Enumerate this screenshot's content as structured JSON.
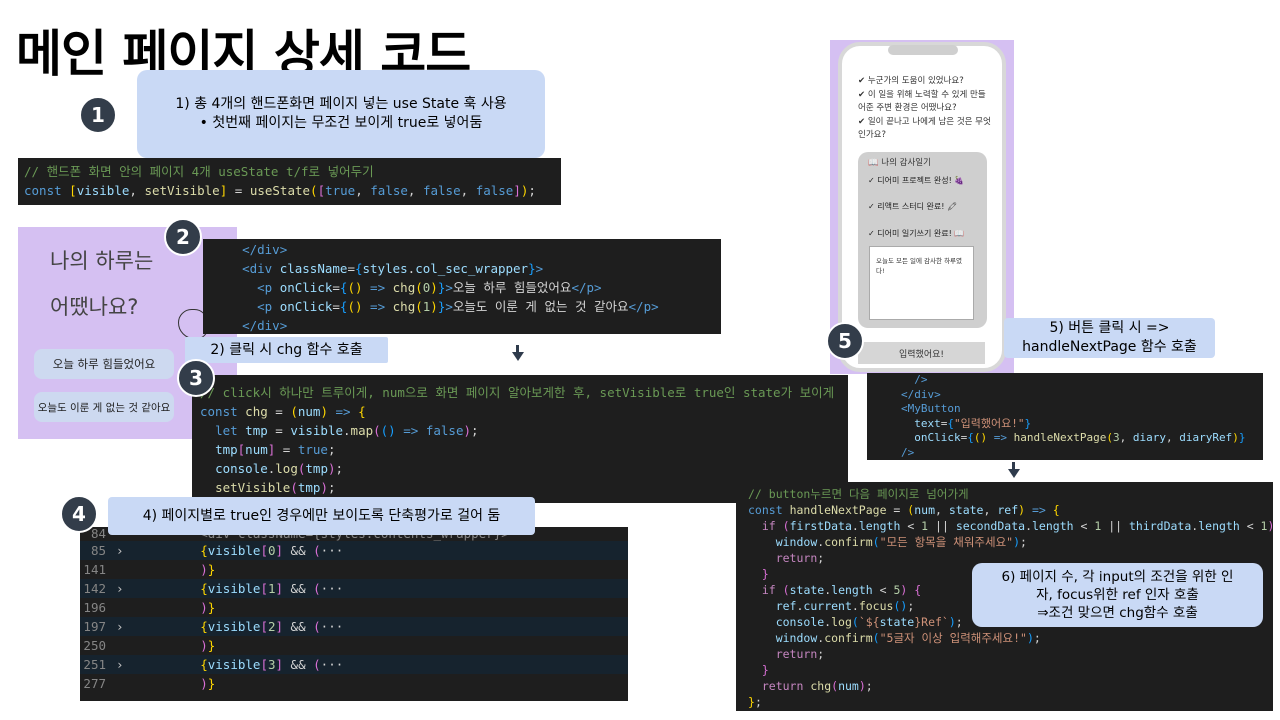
{
  "title": "메인 페이지 상세 코드",
  "badges": [
    "1",
    "2",
    "3",
    "4",
    "5"
  ],
  "notes": {
    "n1_line1": "1) 총 4개의 핸드폰화면 페이지 넣는 use State 훅 사용",
    "n1_line2": "• 첫번째 페이지는 무조건 보이게 true로 넣어둠",
    "n2": "2) 클릭 시 chg 함수 호출",
    "n4": "4) 페이지별로 true인 경우에만 보이도록 단축평가로 걸어 둠",
    "n5_line1": "5) 버튼 클릭 시 =>",
    "n5_line2": "handleNextPage 함수 호출",
    "n6_line1": "6) 페이지 수, 각 input의 조건을 위한 인",
    "n6_line2": "자, focus위한 ref 인자 호출",
    "n6_line3": "⇒조건 맞으면 chg함수 호출"
  },
  "left_screen": {
    "heading_line1": "나의 하루는",
    "heading_line2": "어땠나요?",
    "option1": "오늘 하루 힘들었어요",
    "option2": "오늘도 이룬 게 없는 것 같아요"
  },
  "phone": {
    "q1": "✔ 누군가의 도움이 있었나요?",
    "q2a": "✔ 이 일을 위해 노력할 수 있게 만들",
    "q2b": "어준 주변 환경은 어땠나요?",
    "q3a": "✔ 일이 끝나고 나에게 남은 것은 무엇",
    "q3b": "인가요?",
    "diary_title": "📖 나의 감사일기",
    "item1": "✓ 디어미 프로젝트 완성! 🍇",
    "item2": "✓ 리액트 스터디 완료! 🖍",
    "item3": "✓ 디어미 일기쓰기 완료! 📖",
    "textarea": "오늘도 모든 일에 감사한 하루였다!",
    "button": "입력했어요!"
  },
  "colors": {
    "note_bg": "#c9d9f5",
    "code_bg": "#1e1e1e",
    "badge_bg": "#333d4a",
    "screen_bg": "#d5c0f2"
  }
}
